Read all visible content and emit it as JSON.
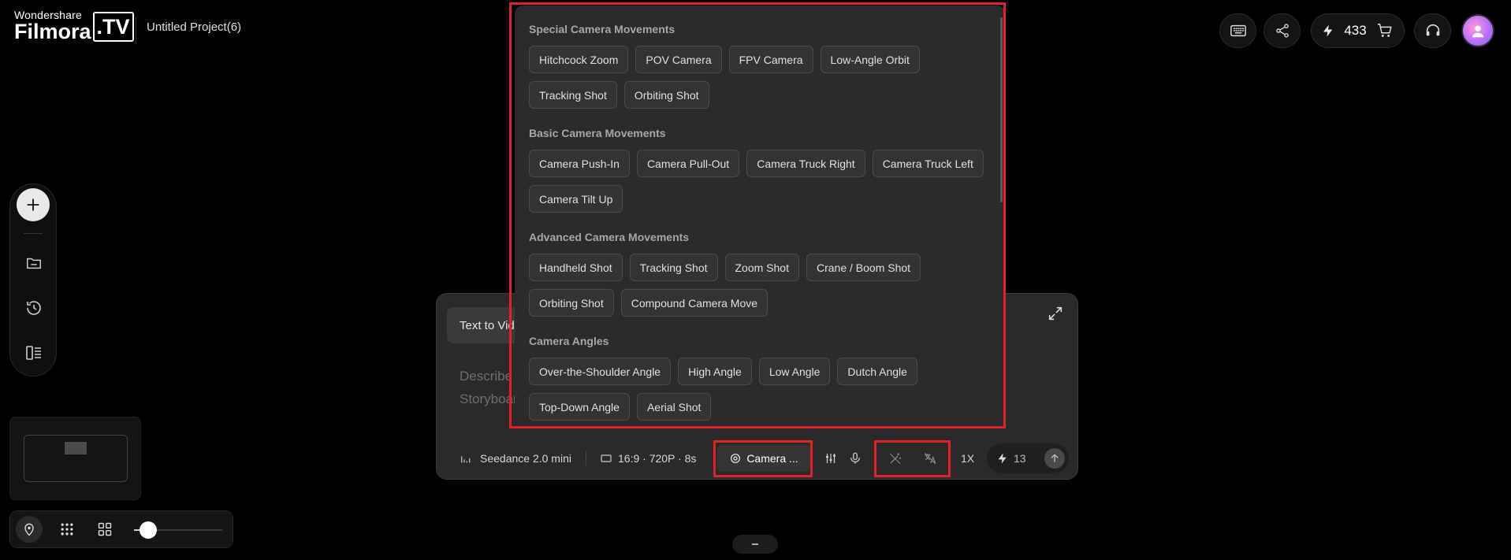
{
  "app": {
    "logo_top": "Wondershare",
    "logo_main": "Filmora",
    "logo_tv": ".TV",
    "project_title": "Untitled Project(6)"
  },
  "header": {
    "credits": "433"
  },
  "prompt": {
    "mode_tab": "Text to Video",
    "placeholder": "Describe your video or use @ to reference materials. You can also press Space to open Storyboard",
    "model": "Seedance 2.0 mini",
    "aspect": "16:9 · 720P · 8s",
    "camera_label": "Camera ...",
    "speed": "1X",
    "cost": "13"
  },
  "dropdown": {
    "sections": [
      {
        "title": "Special Camera Movements",
        "items": [
          "Hitchcock Zoom",
          "POV Camera",
          "FPV Camera",
          "Low-Angle Orbit",
          "Tracking Shot",
          "Orbiting Shot"
        ]
      },
      {
        "title": "Basic Camera Movements",
        "items": [
          "Camera Push-In",
          "Camera Pull-Out",
          "Camera Truck Right",
          "Camera Truck Left",
          "Camera Tilt Up"
        ]
      },
      {
        "title": "Advanced Camera Movements",
        "items": [
          "Handheld Shot",
          "Tracking Shot",
          "Zoom Shot",
          "Crane / Boom Shot",
          "Orbiting Shot",
          "Compound Camera Move"
        ]
      },
      {
        "title": "Camera Angles",
        "items": [
          "Over-the-Shoulder Angle",
          "High Angle",
          "Low Angle",
          "Dutch Angle",
          "Top-Down Angle",
          "Aerial Shot"
        ]
      }
    ]
  },
  "zoom": {
    "level_fraction": 0.16
  },
  "colors": {
    "highlight": "#e0202a",
    "panel": "#2a2a2a",
    "chip": "#333333"
  }
}
